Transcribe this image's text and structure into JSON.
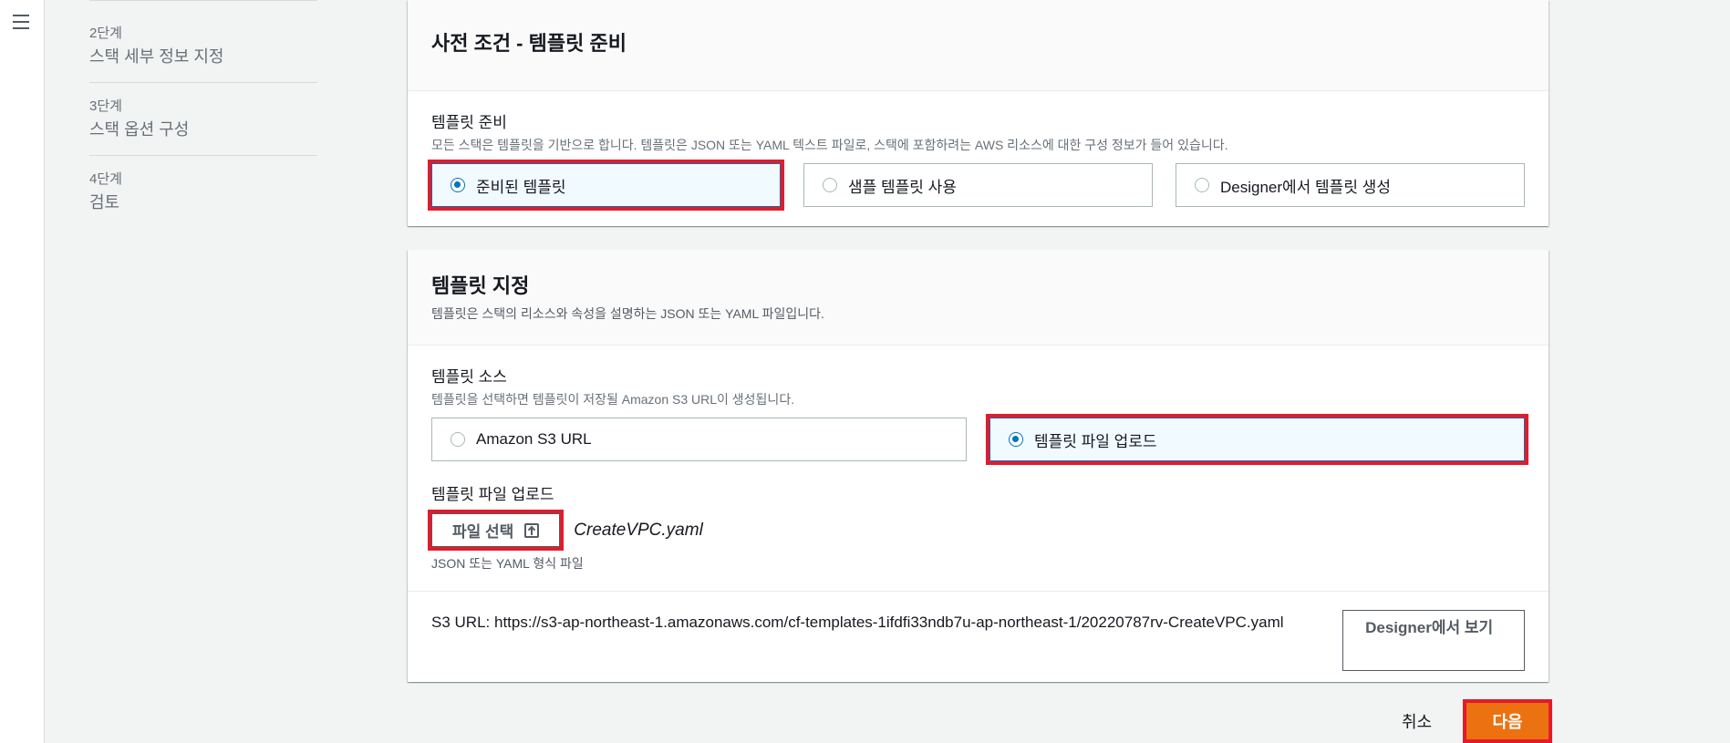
{
  "nav": {
    "steps": [
      {
        "num": "2단계",
        "title": "스택 세부 정보 지정"
      },
      {
        "num": "3단계",
        "title": "스택 옵션 구성"
      },
      {
        "num": "4단계",
        "title": "검토"
      }
    ]
  },
  "prereq": {
    "title": "사전 조건 - 템플릿 준비",
    "field_label": "템플릿 준비",
    "field_desc": "모든 스택은 템플릿을 기반으로 합니다. 템플릿은 JSON 또는 YAML 텍스트 파일로, 스택에 포함하려는 AWS 리소스에 대한 구성 정보가 들어 있습니다.",
    "options": [
      "준비된 템플릿",
      "샘플 템플릿 사용",
      "Designer에서 템플릿 생성"
    ],
    "selected": "준비된 템플릿"
  },
  "specify": {
    "title": "템플릿 지정",
    "desc": "템플릿은 스택의 리소스와 속성을 설명하는 JSON 또는 YAML 파일입니다.",
    "source_label": "템플릿 소스",
    "source_desc": "템플릿을 선택하면 템플릿이 저장될 Amazon S3 URL이 생성됩니다.",
    "source_options": [
      "Amazon S3 URL",
      "템플릿 파일 업로드"
    ],
    "source_selected": "템플릿 파일 업로드",
    "upload_label": "템플릿 파일 업로드",
    "file_button": "파일 선택",
    "file_name": "CreateVPC.yaml",
    "file_hint": "JSON 또는 YAML 형식 파일",
    "s3_label": "S3 URL:",
    "s3_url": "https://s3-ap-northeast-1.amazonaws.com/cf-templates-1ifdfi33ndb7u-ap-northeast-1/20220787rv-CreateVPC.yaml",
    "designer_button": "Designer에서 보기"
  },
  "footer": {
    "cancel": "취소",
    "next": "다음"
  },
  "colors": {
    "accent": "#0073bb",
    "primary_button": "#ec7211",
    "highlight": "#e31b2a"
  }
}
